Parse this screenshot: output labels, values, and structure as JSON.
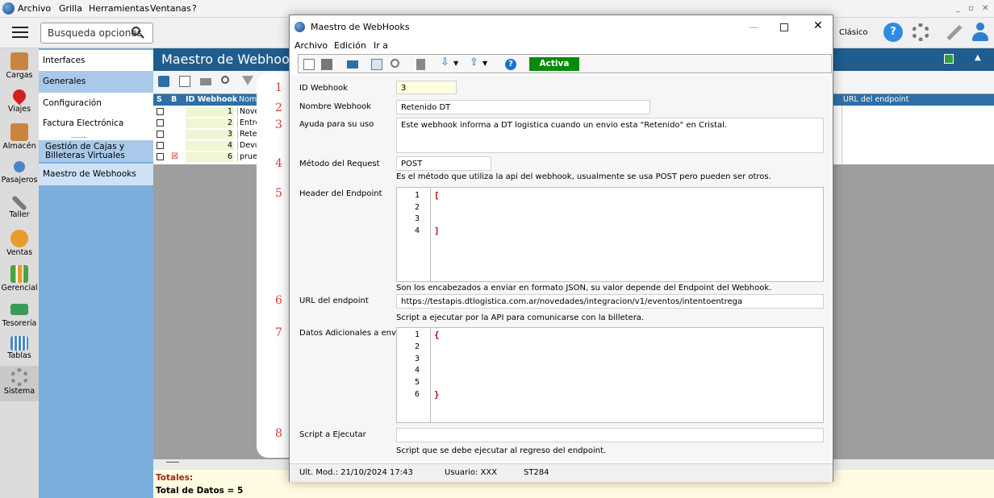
{
  "app": {
    "menu": [
      "Archivo",
      "Grilla",
      "Herramientas",
      "Ventanas",
      "?"
    ],
    "search_placeholder": "Busqueda opciones",
    "mode_label": "Clásico"
  },
  "leftbar": [
    {
      "label": "Cargas",
      "icon": "box-icon",
      "color": "#c9853f"
    },
    {
      "label": "Viajes",
      "icon": "map-pin-icon",
      "color": "#d01f1f"
    },
    {
      "label": "Almacén",
      "icon": "warehouse-icon",
      "color": "#c9853f"
    },
    {
      "label": "Pasajeros",
      "icon": "passenger-icon",
      "color": "#4a86c5"
    },
    {
      "label": "Taller",
      "icon": "tools-icon",
      "color": "#7a7a7a"
    },
    {
      "label": "Ventas",
      "icon": "sales-icon",
      "color": "#e69d2a"
    },
    {
      "label": "Gerencial",
      "icon": "chart-icon",
      "color": "#47a447"
    },
    {
      "label": "Tesorería",
      "icon": "cash-icon",
      "color": "#3a9a5a"
    },
    {
      "label": "Tablas",
      "icon": "table-icon",
      "color": "#4a86c5"
    },
    {
      "label": "Sistema",
      "icon": "gear-icon",
      "color": "#8a8a8a"
    }
  ],
  "midmenu": [
    "Interfaces",
    "Generales",
    "Configuración",
    "Factura Electrónica",
    ".........",
    "Gestión de Cajas y Billeteras Virtuales",
    "Maestro de Webhooks"
  ],
  "bg": {
    "title": "Maestro de Webhook",
    "columns": {
      "s": "S",
      "b": "B",
      "id": "ID Webhook",
      "nombre": "Nomb",
      "url": "URL del endpoint"
    },
    "rows": [
      {
        "id": "1",
        "name": "Nove"
      },
      {
        "id": "2",
        "name": "Entre"
      },
      {
        "id": "3",
        "name": "Reter"
      },
      {
        "id": "4",
        "name": "Devu"
      },
      {
        "id": "6",
        "name": "prueb"
      }
    ],
    "totals_label": "Totales:",
    "total_datos": "Total de Datos = 5"
  },
  "dialog": {
    "title": "Maestro de WebHooks",
    "menu": [
      "Archivo",
      "Edición",
      "Ir a"
    ],
    "activa": "Activa",
    "fields": {
      "id": {
        "num": "1",
        "label": "ID Webhook",
        "value": "3"
      },
      "nombre": {
        "num": "2",
        "label": "Nombre Webhook",
        "value": "Retenido DT"
      },
      "ayuda": {
        "num": "3",
        "label": "Ayuda para su uso",
        "value": "Este webhook informa a DT logistica cuando un envio esta \"Retenido\" en Cristal."
      },
      "metodo": {
        "num": "4",
        "label": "Método del Request",
        "value": "POST",
        "hint": "Es el método que utiliza la api del webhook, usualmente se usa POST pero pueden ser otros."
      },
      "header": {
        "num": "5",
        "label": "Header del Endpoint",
        "lines": [
          "1",
          "2",
          "3",
          "4"
        ],
        "open": "[",
        "close": "]",
        "hint": "Son los encabezados a enviar en formato JSON, su valor depende del Endpoint del Webhook."
      },
      "url": {
        "num": "6",
        "label": "URL del endpoint",
        "value": "https://testapis.dtlogistica.com.ar/novedades/integracion/v1/eventos/intentoentrega",
        "hint": "Script a ejecutar por la API para comunicarse con la billetera."
      },
      "datos": {
        "num": "7",
        "label": "Datos Adicionales a enviar",
        "lines": [
          "1",
          "2",
          "3",
          "4",
          "5",
          "6"
        ],
        "open": "{",
        "close": "}"
      },
      "script": {
        "num": "8",
        "label": "Script a Ejecutar",
        "value": "",
        "hint": "Script que se debe ejecutar al regreso del endpoint."
      }
    },
    "status": {
      "ult": "Ult. Mod.: 21/10/2024 17:43",
      "usuario": "Usuario: XXX",
      "code": "ST284"
    }
  }
}
